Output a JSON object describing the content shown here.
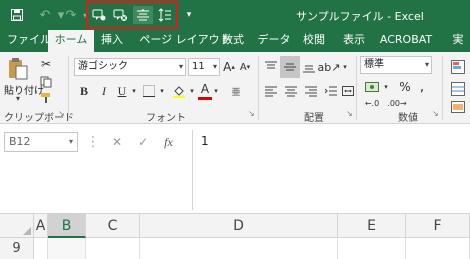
{
  "app": {
    "title": "サンプルファイル  -  Excel",
    "accent_color": "#217346",
    "highlight_color": "#e01b1b"
  },
  "qat": {
    "icons": [
      "save-icon",
      "undo-icon",
      "redo-icon",
      "show-changes-icon",
      "track-changes-icon",
      "align-center-icon",
      "line-spacing-icon",
      "customize-qat-icon"
    ]
  },
  "tabs": [
    {
      "label": "ファイル"
    },
    {
      "label": "ホーム"
    },
    {
      "label": "挿入"
    },
    {
      "label": "ページ レイアウト"
    },
    {
      "label": "数式"
    },
    {
      "label": "データ"
    },
    {
      "label": "校閲"
    },
    {
      "label": "表示"
    },
    {
      "label": "ACROBAT"
    },
    {
      "label": "実"
    }
  ],
  "ribbon": {
    "clipboard": {
      "paste_label": "貼り付け",
      "group_label": "クリップボード"
    },
    "font": {
      "font_name": "游ゴシック",
      "font_size": "11",
      "group_label": "フォント",
      "bold": "B",
      "italic": "I",
      "underline": "U",
      "grow": "A",
      "shrink": "A",
      "font_color_glyph": "A"
    },
    "alignment": {
      "group_label": "配置"
    },
    "number": {
      "format": "標準",
      "group_label": "数値",
      "percent": "%",
      "comma": ","
    }
  },
  "formula_bar": {
    "name_box": "B12",
    "cancel": "✕",
    "enter": "✓",
    "fx": "fx",
    "content": "1"
  },
  "grid": {
    "columns": [
      "A",
      "B",
      "C",
      "D",
      "E",
      "F"
    ],
    "selected_column": "B",
    "rows": [
      "9"
    ]
  }
}
